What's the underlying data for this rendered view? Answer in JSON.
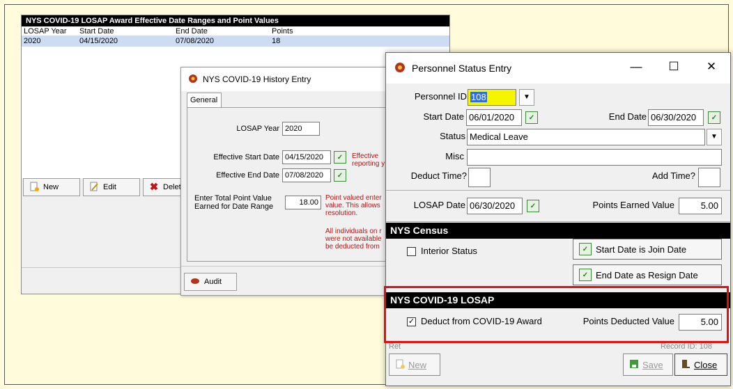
{
  "award_window": {
    "title": "NYS COVID-19 LOSAP Award Effective Date Ranges and Point Values",
    "columns": [
      "LOSAP Year",
      "Start Date",
      "End Date",
      "Points"
    ],
    "rows": [
      {
        "year": "2020",
        "start": "04/15/2020",
        "end": "07/08/2020",
        "points": "18"
      }
    ],
    "buttons": {
      "new": "New",
      "edit": "Edit",
      "delete": "Delete"
    }
  },
  "history_window": {
    "title": "NYS COVID-19 History Entry",
    "tab": "General",
    "losap_year_label": "LOSAP Year",
    "losap_year": "2020",
    "eff_start_label": "Effective Start Date",
    "eff_start": "04/15/2020",
    "eff_end_label": "Effective End Date",
    "eff_end": "07/08/2020",
    "points_label_1": "Enter Total Point Value",
    "points_label_2": "Earned for Date Range",
    "points_value": "18.00",
    "red_text_1_a": "Effective",
    "red_text_1_b": "reporting y",
    "red_text_2_a": "Point valued enter",
    "red_text_2_b": "value.  This allows",
    "red_text_2_c": "resolution.",
    "red_text_3_a": "All individuals on r",
    "red_text_3_b": "were not available",
    "red_text_3_c": "be deducted from",
    "audit_label": "Audit"
  },
  "pse_window": {
    "title": "Personnel Status Entry",
    "minimize": "—",
    "maximize": "☐",
    "close": "✕",
    "personnel_id_label": "Personnel ID",
    "personnel_id": "108",
    "start_date_label": "Start Date",
    "start_date": "06/01/2020",
    "end_date_label": "End Date",
    "end_date": "06/30/2020",
    "status_label": "Status",
    "status_value": "Medical Leave",
    "misc_label": "Misc",
    "misc_value": "",
    "deduct_time_label": "Deduct Time?",
    "add_time_label": "Add Time?",
    "losap_date_label": "LOSAP Date",
    "losap_date": "06/30/2020",
    "points_earned_label": "Points Earned Value",
    "points_earned": "5.00",
    "census_header": "NYS Census",
    "interior_status_label": "Interior Status",
    "start_join_btn": "Start Date is Join Date",
    "end_resign_btn": "End Date as Resign Date",
    "covid_header": "NYS COVID-19 LOSAP",
    "deduct_covid_label": "Deduct from COVID-19 Award",
    "points_deducted_label": "Points Deducted Value",
    "points_deducted": "5.00",
    "new_label": "New",
    "save_label": "Save",
    "close_label": "Close",
    "partial_left": "Ret",
    "partial_right": "Record ID: 108"
  }
}
